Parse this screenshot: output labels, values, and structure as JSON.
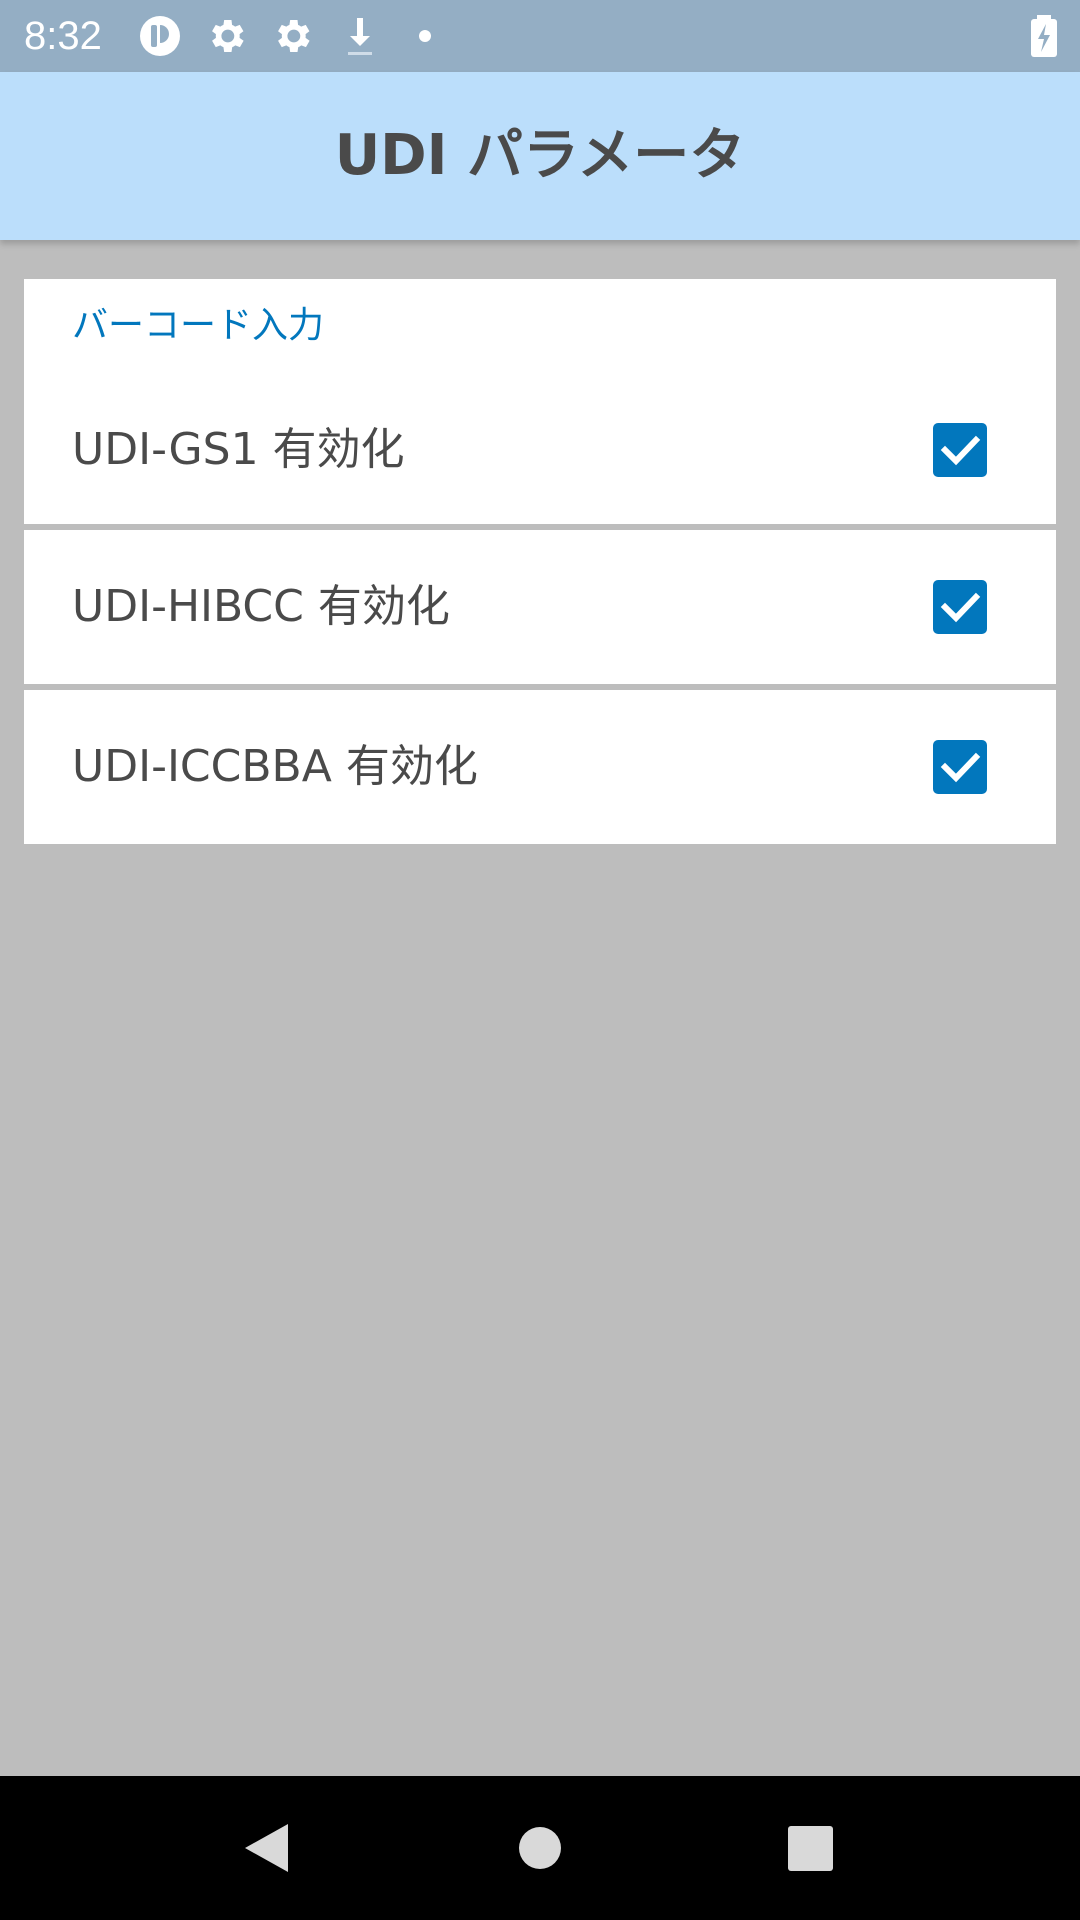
{
  "status_bar": {
    "time": "8:32",
    "icons": [
      "app-badge-icon",
      "gear-icon",
      "gear-icon",
      "download-icon",
      "dot-icon",
      "battery-charging-icon"
    ]
  },
  "app_bar": {
    "title": "UDI パラメータ"
  },
  "preferences": {
    "category": "バーコード入力",
    "items": [
      {
        "label": "UDI-GS1 有効化",
        "checked": true
      },
      {
        "label": "UDI-HIBCC 有効化",
        "checked": true
      },
      {
        "label": "UDI-ICCBBA 有効化",
        "checked": true
      }
    ]
  },
  "nav_bar": {
    "buttons": [
      "back-icon",
      "home-icon",
      "recents-icon"
    ]
  },
  "colors": {
    "status_bar": "#94aec4",
    "app_bar": "#bbdefb",
    "accent": "#0277bd",
    "background": "#bdbdbd",
    "card": "#ffffff",
    "text": "#4a4a4a"
  }
}
